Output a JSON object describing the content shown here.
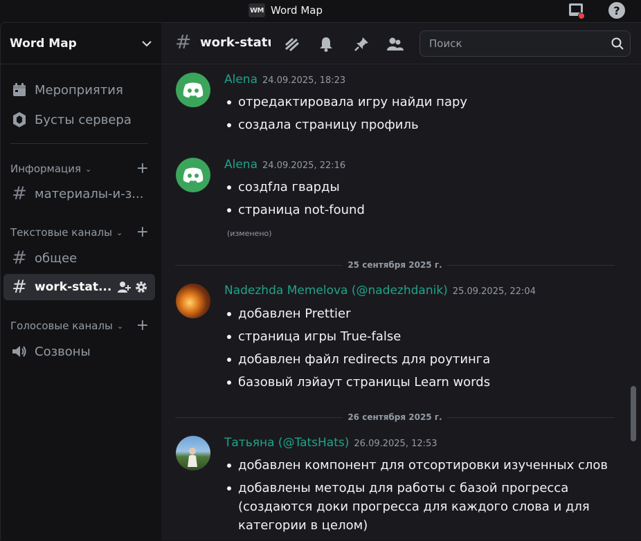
{
  "app": {
    "title": "Word Map",
    "logo_text": "WM"
  },
  "server": {
    "name": "Word Map"
  },
  "sidebar": {
    "top_items": [
      {
        "label": "Мероприятия",
        "icon": "calendar-icon"
      },
      {
        "label": "Бусты сервера",
        "icon": "boost-icon"
      }
    ],
    "categories": [
      {
        "label": "Информация",
        "channels": [
          "материалы-и-з..."
        ]
      },
      {
        "label": "Текстовые каналы",
        "channels": [
          "общее",
          "work-stat..."
        ]
      },
      {
        "label": "Голосовые каналы",
        "channels": [
          "Созвоны"
        ]
      }
    ]
  },
  "channel": {
    "name": "work-status"
  },
  "search": {
    "placeholder": "Поиск"
  },
  "colors": {
    "accent_author": "#1fa38a",
    "discord_green": "#3ba55c",
    "notify_red": "#f23f43"
  },
  "messages": [
    {
      "author": "Alena",
      "timestamp": "24.09.2025, 18:23",
      "avatar": "discord-logo-icon",
      "bullets": [
        "отредактировала игру найди пару",
        "создала страницу профиль"
      ]
    },
    {
      "author": "Alena",
      "timestamp": "24.09.2025, 22:16",
      "avatar": "discord-logo-icon",
      "bullets": [
        "создfла гварды",
        "страница not-found"
      ],
      "edited": "(изменено)"
    },
    {
      "author": "Nadezhda Memelova (@nadezhdanik)",
      "timestamp": "25.09.2025, 22:04",
      "avatar": "autumn-photo",
      "bullets": [
        "добавлен Prettier",
        "страница игры True-false",
        "добавлен файл redirects для роутинга",
        "базовый лэйаут страницы Learn words"
      ]
    },
    {
      "author": "Татьяна (@TatsHats)",
      "timestamp": "26.09.2025, 12:53",
      "avatar": "person-photo",
      "bullets": [
        "добавлен компонент для отсортировки изученных слов",
        "добавлены методы для работы с базой прогресса (создаются доки прогресса для каждого слова и для категории в целом)"
      ]
    }
  ],
  "date_dividers": [
    "25 сентября 2025 г.",
    "26 сентября 2025 г."
  ]
}
